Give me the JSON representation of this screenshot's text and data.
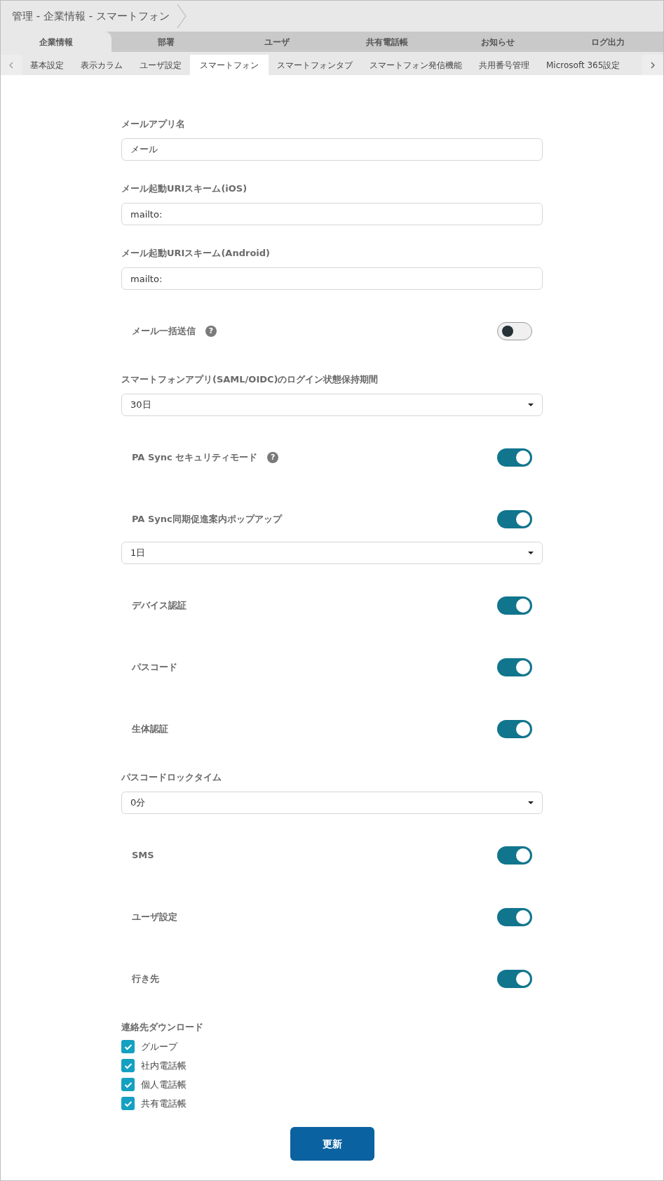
{
  "breadcrumb": "管理 - 企業情報 - スマートフォン",
  "main_tabs": [
    {
      "label": "企業情報",
      "selected": true
    },
    {
      "label": "部署",
      "selected": false
    },
    {
      "label": "ユーザ",
      "selected": false
    },
    {
      "label": "共有電話帳",
      "selected": false
    },
    {
      "label": "お知らせ",
      "selected": false
    },
    {
      "label": "ログ出力",
      "selected": false
    }
  ],
  "sub_tabs": [
    {
      "label": "基本設定",
      "selected": false
    },
    {
      "label": "表示カラム",
      "selected": false
    },
    {
      "label": "ユーザ設定",
      "selected": false
    },
    {
      "label": "スマートフォン",
      "selected": true
    },
    {
      "label": "スマートフォンタブ",
      "selected": false
    },
    {
      "label": "スマートフォン発信機能",
      "selected": false
    },
    {
      "label": "共用番号管理",
      "selected": false
    },
    {
      "label": "Microsoft 365設定",
      "selected": false
    }
  ],
  "form": [
    {
      "kind": "text",
      "label": "メールアプリ名",
      "value": "メール"
    },
    {
      "kind": "text",
      "label": "メール起動URIスキーム(iOS)",
      "value": "mailto:"
    },
    {
      "kind": "text",
      "label": "メール起動URIスキーム(Android)",
      "value": "mailto:"
    },
    {
      "kind": "toggle",
      "label": "メール一括送信",
      "help": "?",
      "on": false
    },
    {
      "kind": "select",
      "label": "スマートフォンアプリ(SAML/OIDC)のログイン状態保持期間",
      "value": "30日"
    },
    {
      "kind": "toggle",
      "label": "PA Sync セキュリティモード",
      "help": "?",
      "on": true
    },
    {
      "kind": "toggle_select",
      "label": "PA Sync同期促進案内ポップアップ",
      "on": true,
      "value": "1日"
    },
    {
      "kind": "toggle",
      "label": "デバイス認証",
      "on": true
    },
    {
      "kind": "toggle",
      "label": "パスコード",
      "on": true
    },
    {
      "kind": "toggle",
      "label": "生体認証",
      "on": true
    },
    {
      "kind": "select",
      "label": "パスコードロックタイム",
      "value": "0分"
    },
    {
      "kind": "toggle",
      "label": "SMS",
      "on": true
    },
    {
      "kind": "toggle",
      "label": "ユーザ設定",
      "on": true
    },
    {
      "kind": "toggle",
      "label": "行き先",
      "on": true
    },
    {
      "kind": "checkboxes",
      "label": "連絡先ダウンロード",
      "items": [
        {
          "label": "グループ",
          "checked": true
        },
        {
          "label": "社内電話帳",
          "checked": true
        },
        {
          "label": "個人電話帳",
          "checked": true
        },
        {
          "label": "共有電話帳",
          "checked": true
        }
      ]
    }
  ],
  "submit": "更新"
}
